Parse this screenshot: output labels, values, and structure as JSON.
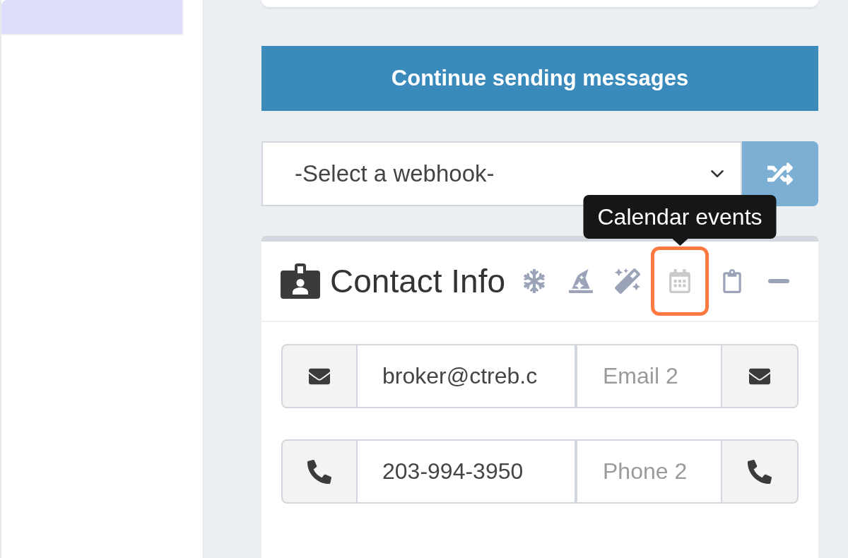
{
  "send_button": {
    "label": "Continue sending messages"
  },
  "webhook_select": {
    "value": "-Select a webhook-"
  },
  "contact_card": {
    "title": "Contact Info",
    "tools": [
      {
        "kind": "snowflake",
        "highlighted": false
      },
      {
        "kind": "wizard_hat",
        "highlighted": false
      },
      {
        "kind": "magic_wand",
        "highlighted": false
      },
      {
        "kind": "calendar",
        "highlighted": true,
        "tooltip": "Calendar events"
      },
      {
        "kind": "clipboard",
        "highlighted": false
      },
      {
        "kind": "collapse",
        "highlighted": false
      }
    ],
    "rows": [
      {
        "kind": "email",
        "value": "broker@ctreb.c",
        "placeholder": "Email 2"
      },
      {
        "kind": "phone",
        "value": "203-994-3950",
        "placeholder": "Phone 2"
      }
    ]
  }
}
